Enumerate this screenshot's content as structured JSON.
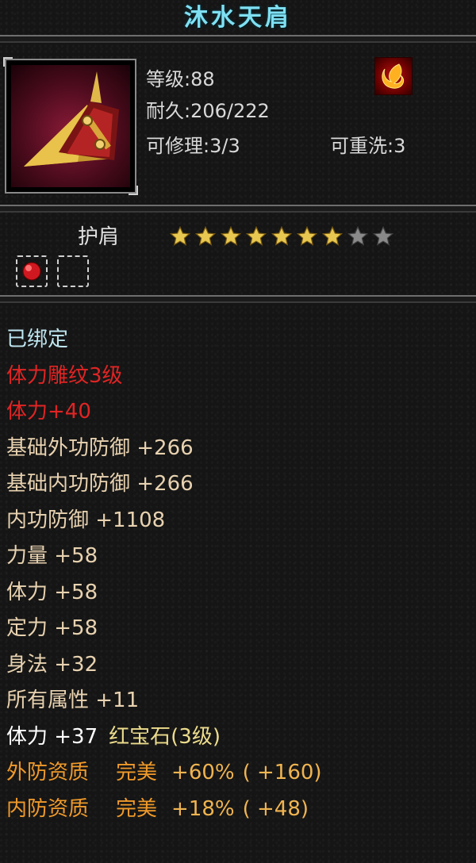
{
  "item": {
    "name": "沐水天肩",
    "level": "等级:88",
    "durability": "耐久:206/222",
    "repair": "可修理:3/3",
    "rewash": "可重洗:3",
    "type": "护肩",
    "stars_total": 9,
    "stars_filled": 7,
    "item_icon": "golden-spiked-shoulder-armor-icon",
    "element_icon": "fire-element-icon",
    "gem_slots": [
      "ruby-gem-socket-icon",
      "empty-gem-socket-icon"
    ]
  },
  "attributes": [
    {
      "text": "已绑定",
      "color": "#bfe6f0"
    },
    {
      "text": "体力雕纹3级",
      "color": "#e02424"
    },
    {
      "text": "体力+40",
      "color": "#e02424"
    },
    {
      "text": "基础外功防御  +266",
      "color": "#e8d2b0"
    },
    {
      "text": "基础内功防御  +266",
      "color": "#e8d2b0"
    },
    {
      "text": "内功防御  +1108",
      "color": "#e8d2b0"
    },
    {
      "text": "力量  +58",
      "color": "#e8d2b0"
    },
    {
      "text": "体力  +58",
      "color": "#e8d2b0"
    },
    {
      "text": "定力  +58",
      "color": "#e8d2b0"
    },
    {
      "text": "身法  +32",
      "color": "#e8d2b0"
    },
    {
      "text": "所有属性  +11",
      "color": "#e8d2b0"
    }
  ],
  "gem_line": {
    "stat": "体力  +37",
    "gem": "红宝石(3级)"
  },
  "quality": [
    {
      "label": "外防资质",
      "grade": "完美",
      "value": "+60%",
      "bonus": "( +160)"
    },
    {
      "label": "内防资质",
      "grade": "完美",
      "value": "+18%",
      "bonus": "( +48)"
    }
  ]
}
